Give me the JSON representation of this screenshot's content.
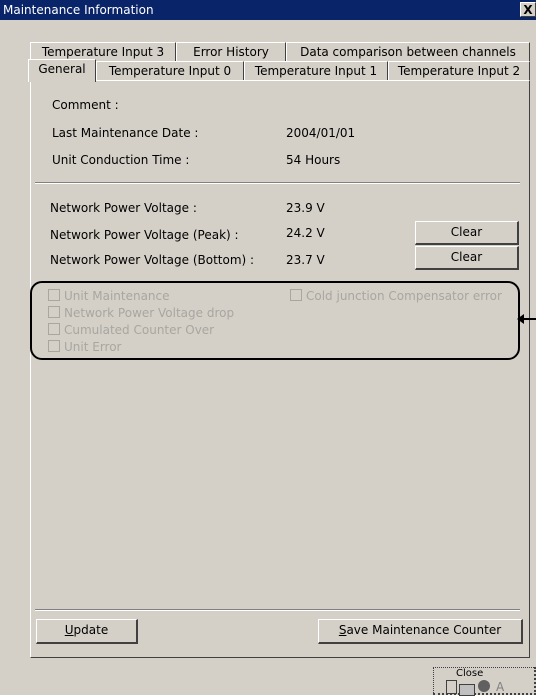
{
  "window": {
    "title": "Maintenance Information",
    "close_glyph": "X"
  },
  "tabs_back": [
    {
      "label": "Temperature Input 3"
    },
    {
      "label": "Error History"
    },
    {
      "label": "Data comparison between channels"
    }
  ],
  "tabs_front": [
    {
      "label": "General",
      "active": true
    },
    {
      "label": "Temperature Input 0"
    },
    {
      "label": "Temperature Input 1"
    },
    {
      "label": "Temperature Input 2"
    }
  ],
  "info": {
    "comment_label": "Comment :",
    "last_maintenance_label": "Last Maintenance Date :",
    "last_maintenance_value": "2004/01/01",
    "conduction_label": "Unit Conduction Time :",
    "conduction_value": "54 Hours"
  },
  "voltage": {
    "network_label": "Network Power Voltage :",
    "network_value": "23.9 V",
    "peak_label": "Network Power Voltage (Peak) :",
    "peak_value": "24.2 V",
    "bottom_label": "Network Power Voltage (Bottom) :",
    "bottom_value": "23.7 V",
    "clear_label": "Clear"
  },
  "status_checks": {
    "unit_maintenance": "Unit Maintenance",
    "voltage_drop": "Network Power Voltage drop",
    "counter_over": "Cumulated Counter Over",
    "unit_error": "Unit Error",
    "cold_junction": "Cold junction Compensator error"
  },
  "buttons": {
    "update_accel": "U",
    "update_rest": "pdate",
    "save_accel": "S",
    "save_rest": "ave Maintenance Counter",
    "close_label": "Close"
  },
  "colors": {
    "face": "#d4d0c8",
    "title_bar": "#0a246a",
    "disabled_text": "#a8a6a0"
  }
}
